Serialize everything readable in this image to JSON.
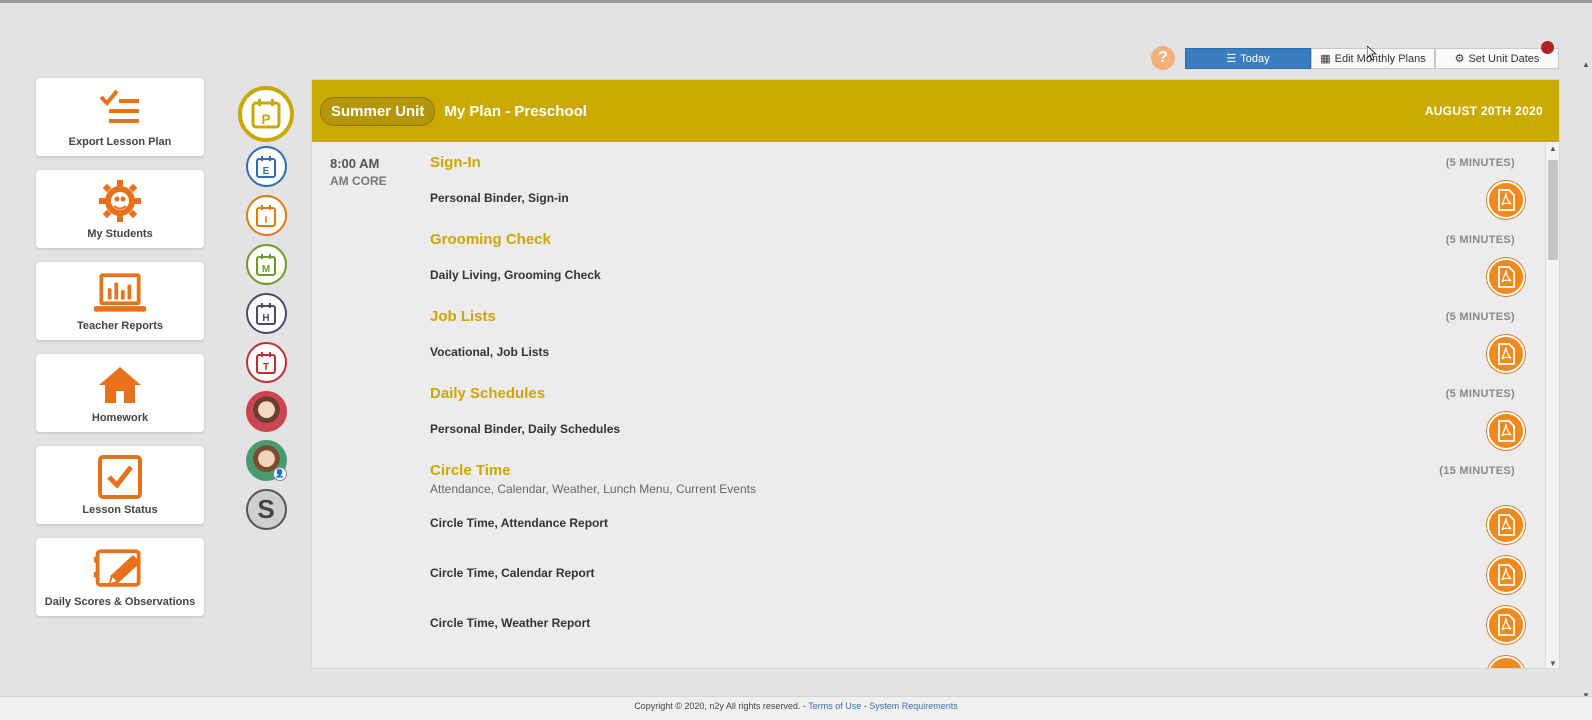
{
  "nav": {
    "items": [
      {
        "label": "Export Lesson Plan",
        "icon": "export-list-icon"
      },
      {
        "label": "My Students",
        "icon": "students-gear-icon"
      },
      {
        "label": "Teacher Reports",
        "icon": "reports-laptop-icon"
      },
      {
        "label": "Homework",
        "icon": "home-icon"
      },
      {
        "label": "Lesson Status",
        "icon": "checkbox-icon"
      },
      {
        "label": "Daily Scores & Observations",
        "icon": "clipboard-pencil-icon"
      }
    ]
  },
  "circles": [
    {
      "letter": "P",
      "color": "#c9a800"
    },
    {
      "letter": "E",
      "color": "#2f6db3"
    },
    {
      "letter": "I",
      "color": "#e07a10"
    },
    {
      "letter": "M",
      "color": "#6f9a2a"
    },
    {
      "letter": "H",
      "color": "#4a4a6a"
    },
    {
      "letter": "T",
      "color": "#c03030"
    },
    {
      "letter": "S",
      "color": "#555555"
    }
  ],
  "toolbar": {
    "help": "?",
    "today": "Today",
    "edit": "Edit Monthly Plans",
    "set": "Set Unit Dates"
  },
  "banner": {
    "unit": "Summer Unit",
    "title": "My Plan - Preschool",
    "date": "AUGUST 20TH 2020"
  },
  "schedule": {
    "time": "8:00 AM",
    "block": "AM CORE",
    "sections": [
      {
        "title": "Sign-In",
        "duration": "(5 MINUTES)",
        "items": [
          "Personal Binder, Sign-in"
        ]
      },
      {
        "title": "Grooming Check",
        "duration": "(5 MINUTES)",
        "items": [
          "Daily Living, Grooming Check"
        ]
      },
      {
        "title": "Job Lists",
        "duration": "(5 MINUTES)",
        "items": [
          "Vocational, Job Lists"
        ]
      },
      {
        "title": "Daily Schedules",
        "duration": "(5 MINUTES)",
        "items": [
          "Personal Binder, Daily Schedules"
        ]
      },
      {
        "title": "Circle Time",
        "duration": "(15 MINUTES)",
        "subtitle": "Attendance, Calendar, Weather, Lunch Menu, Current Events",
        "items": [
          "Circle Time, Attendance Report",
          "Circle Time, Calendar Report",
          "Circle Time, Weather Report"
        ]
      }
    ]
  },
  "footer": {
    "copyright": "Copyright © 2020, n2y All rights reserved. - ",
    "terms": "Terms of Use",
    "sep": " - ",
    "sysreq": "System Requirements"
  }
}
